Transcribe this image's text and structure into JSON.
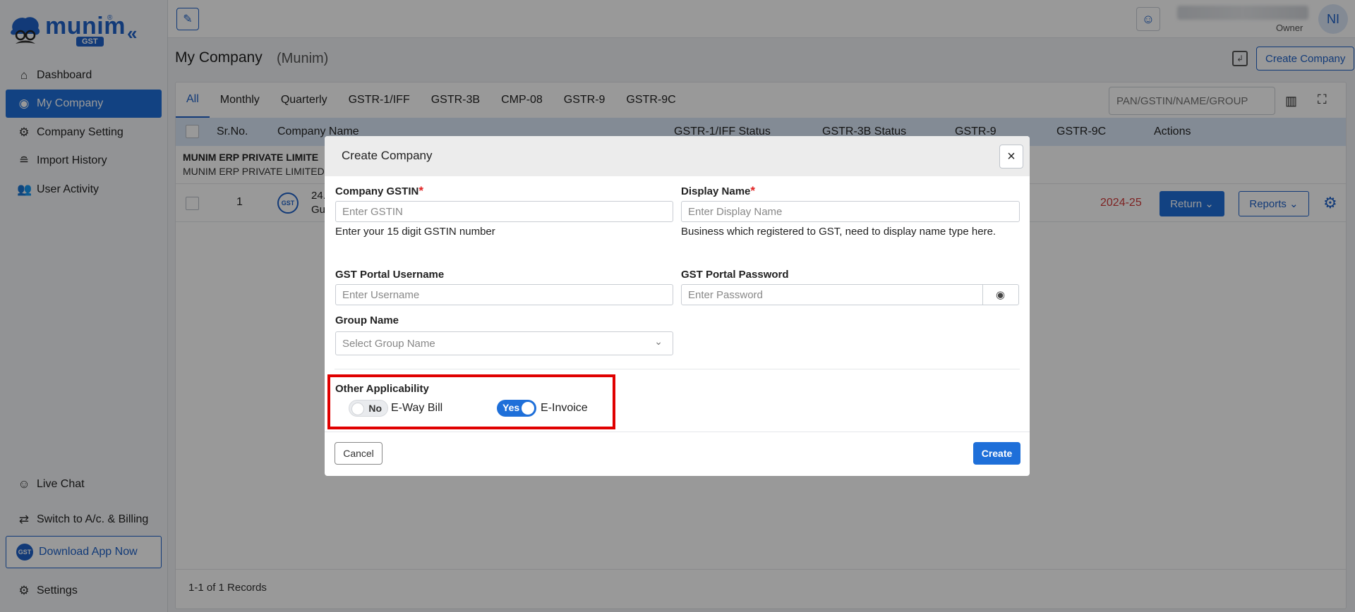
{
  "app": {
    "logo_text": "munim",
    "logo_badge": "GST",
    "logo_reg": "®"
  },
  "sidebar": {
    "items": [
      {
        "label": "Dashboard",
        "icon": "home-icon"
      },
      {
        "label": "My Company",
        "icon": "eye-icon"
      },
      {
        "label": "Company Setting",
        "icon": "gear-icon"
      },
      {
        "label": "Import History",
        "icon": "database-icon"
      },
      {
        "label": "User Activity",
        "icon": "users-icon"
      }
    ],
    "bottom": {
      "live_chat": "Live Chat",
      "switch": "Switch to A/c. & Billing",
      "download": "Download App Now",
      "settings": "Settings"
    }
  },
  "header": {
    "user_role": "Owner",
    "avatar_initials": "NI"
  },
  "page": {
    "title": "My Company",
    "subtitle": "(Munim)",
    "create_button": "Create Company"
  },
  "tabs": [
    "All",
    "Monthly",
    "Quarterly",
    "GSTR-1/IFF",
    "GSTR-3B",
    "CMP-08",
    "GSTR-9",
    "GSTR-9C"
  ],
  "search": {
    "placeholder": "PAN/GSTIN/NAME/GROUP"
  },
  "table": {
    "columns": [
      "Sr.No.",
      "Company Name",
      "GSTR-1/IFF Status",
      "GSTR-3B Status",
      "GSTR-9",
      "GSTR-9C",
      "Actions"
    ],
    "group": {
      "name": "MUNIM ERP PRIVATE LIMITE",
      "sub": "MUNIM ERP PRIVATE LIMITED"
    },
    "rows": [
      {
        "sr": "1",
        "badge": "GST",
        "name_line1": "24.",
        "name_line2": "Gu",
        "year": "2024-25",
        "return_label": "Return",
        "reports_label": "Reports"
      }
    ],
    "records": "1-1 of 1 Records"
  },
  "modal": {
    "title": "Create Company",
    "close": "×",
    "gstin_label": "Company GSTIN",
    "gstin_placeholder": "Enter GSTIN",
    "gstin_help": "Enter your 15 digit GSTIN number",
    "display_label": "Display Name",
    "display_placeholder": "Enter Display Name",
    "display_help": "Business which registered to GST, need to display name type here.",
    "username_label": "GST Portal Username",
    "username_placeholder": "Enter Username",
    "password_label": "GST Portal Password",
    "password_placeholder": "Enter Password",
    "group_label": "Group Name",
    "group_placeholder": "Select Group Name",
    "required_mark": "*",
    "other_label": "Other Applicability",
    "eway": {
      "toggle_text": "No",
      "label": "E-Way Bill",
      "state": "off"
    },
    "einvoice": {
      "toggle_text": "Yes",
      "label": "E-Invoice",
      "state": "on"
    },
    "cancel": "Cancel",
    "create": "Create"
  }
}
